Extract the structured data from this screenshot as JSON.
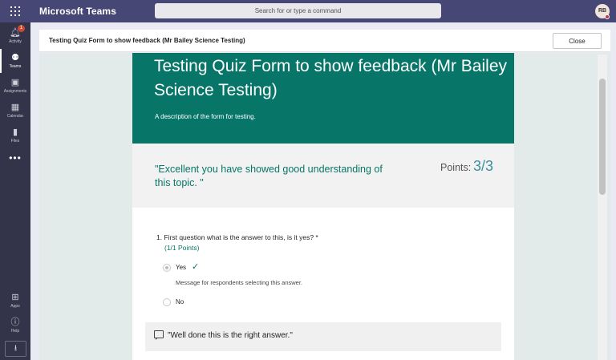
{
  "app": {
    "title": "Microsoft Teams",
    "search_placeholder": "Search for or type a command",
    "avatar_initials": "RB"
  },
  "rail": {
    "activity_badge": "1",
    "items": [
      {
        "label": "Activity",
        "icon": "bell-icon"
      },
      {
        "label": "Teams",
        "icon": "teams-icon"
      },
      {
        "label": "Assignments",
        "icon": "assignments-icon"
      },
      {
        "label": "Calendar",
        "icon": "calendar-icon"
      },
      {
        "label": "Files",
        "icon": "files-icon"
      }
    ],
    "more": "•••",
    "bottom_items": [
      {
        "label": "Apps",
        "icon": "apps-icon"
      },
      {
        "label": "Help",
        "icon": "help-icon"
      }
    ]
  },
  "header": {
    "title": "Testing Quiz Form to show feedback (Mr Bailey Science Testing)",
    "close_label": "Close"
  },
  "form": {
    "title": "Testing Quiz Form to show feedback (Mr Bailey Science Testing)",
    "description": "A description of the form for testing.",
    "overall_feedback": "\"Excellent you have showed good understanding of this topic. \"",
    "points_label": "Points:",
    "points_value": "3/3",
    "question": {
      "text": "1. First question what is the answer to this, is it yes? *",
      "points": "(1/1 Points)",
      "options": [
        {
          "label": "Yes",
          "selected": true,
          "correct": true
        },
        {
          "label": "No",
          "selected": false,
          "correct": false
        }
      ],
      "option_message": "Message for respondents selecting this answer.",
      "answer_feedback": "\"Well done this is the right answer.\""
    }
  },
  "colors": {
    "titlebar": "#464775",
    "rail": "#33344a",
    "form_header": "#077568",
    "accent_text": "#077568",
    "points_value": "#3a8fa3"
  }
}
